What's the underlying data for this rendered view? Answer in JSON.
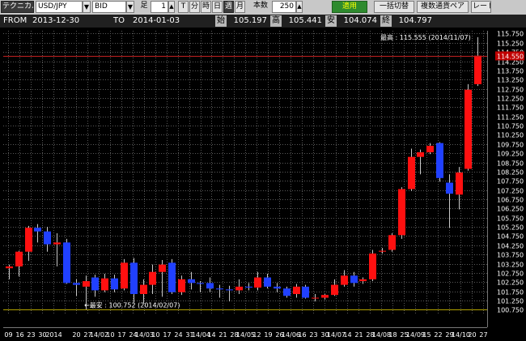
{
  "toolbar": {
    "technical": "テクニカル",
    "pair": "USD/JPY",
    "price_type": "BID",
    "ashi_label": "足",
    "ashi_value": "1",
    "interval_buttons": [
      "T",
      "分",
      "時",
      "日",
      "週",
      "月"
    ],
    "count_label": "本数",
    "count_value": "250",
    "apply": "適用",
    "toggle_all": "一括切替",
    "multi_currency": "複数通貨ペア",
    "rate": "レート"
  },
  "info": {
    "from_label": "FROM",
    "from_value": "2013-12-30",
    "to_label": "TO",
    "to_value": "2014-01-03",
    "open_label": "始",
    "open_value": "105.197",
    "high_label": "高",
    "high_value": "105.441",
    "low_label": "安",
    "low_value": "104.074",
    "close_label": "終",
    "close_value": "104.797"
  },
  "chart_data": {
    "type": "candlestick",
    "ylim": [
      100.5,
      115.9
    ],
    "y_ticks": [
      100.75,
      101.25,
      101.75,
      102.25,
      102.75,
      103.25,
      103.75,
      104.25,
      104.75,
      105.25,
      105.75,
      106.25,
      106.75,
      107.25,
      107.75,
      108.25,
      108.75,
      109.25,
      109.75,
      110.25,
      110.75,
      111.25,
      111.75,
      112.25,
      112.75,
      113.25,
      113.75,
      114.25,
      114.75,
      115.25,
      115.75
    ],
    "y_tick_labels": [
      "100.750",
      "101.250",
      "101.750",
      "102.250",
      "102.750",
      "103.250",
      "103.750",
      "104.250",
      "104.750",
      "105.250",
      "105.750",
      "106.250",
      "106.750",
      "107.250",
      "107.750",
      "108.250",
      "108.750",
      "109.250",
      "109.750",
      "110.250",
      "110.750",
      "111.250",
      "111.750",
      "112.250",
      "112.750",
      "113.250",
      "113.750",
      "114.250",
      "114.750",
      "115.250",
      "115.750"
    ],
    "x_labels": [
      "09",
      "16",
      "23",
      "30",
      "2014",
      "",
      "20",
      "27",
      "14/02",
      "10",
      "17",
      "24",
      "14/03",
      "10",
      "17",
      "24",
      "31",
      "14/04",
      "14",
      "21",
      "28",
      "14/05",
      "12",
      "19",
      "26",
      "14/06",
      "16",
      "23",
      "30",
      "14/07",
      "14",
      "21",
      "28",
      "14/08",
      "18",
      "25",
      "14/09",
      "15",
      "22",
      "29",
      "14/10",
      "20",
      "27"
    ],
    "current_price": 114.55,
    "current_price_label": "114.550",
    "high_annotation": "最高 : 115.555 (2014/11/07)",
    "high_price": 115.555,
    "low_annotation": "←最安 : 100.752 (2014/02/07)",
    "low_price": 100.752,
    "candles": [
      {
        "o": 103.0,
        "h": 103.2,
        "l": 102.4,
        "c": 103.1
      },
      {
        "o": 103.1,
        "h": 103.95,
        "l": 102.55,
        "c": 103.9
      },
      {
        "o": 103.9,
        "h": 105.3,
        "l": 103.4,
        "c": 105.2
      },
      {
        "o": 105.2,
        "h": 105.4,
        "l": 104.4,
        "c": 105.0
      },
      {
        "o": 105.0,
        "h": 105.25,
        "l": 103.9,
        "c": 104.3
      },
      {
        "o": 104.3,
        "h": 104.9,
        "l": 103.1,
        "c": 104.4
      },
      {
        "o": 104.4,
        "h": 104.6,
        "l": 102.15,
        "c": 102.2
      },
      {
        "o": 102.2,
        "h": 102.4,
        "l": 101.5,
        "c": 102.1
      },
      {
        "o": 102.0,
        "h": 102.6,
        "l": 100.752,
        "c": 102.3
      },
      {
        "o": 102.5,
        "h": 102.65,
        "l": 101.45,
        "c": 101.8
      },
      {
        "o": 101.8,
        "h": 102.7,
        "l": 101.7,
        "c": 102.45
      },
      {
        "o": 102.45,
        "h": 102.65,
        "l": 101.7,
        "c": 101.85
      },
      {
        "o": 101.9,
        "h": 103.5,
        "l": 101.8,
        "c": 103.3
      },
      {
        "o": 103.3,
        "h": 103.55,
        "l": 101.15,
        "c": 101.6
      },
      {
        "o": 101.6,
        "h": 102.4,
        "l": 101.1,
        "c": 102.1
      },
      {
        "o": 102.1,
        "h": 103.2,
        "l": 101.6,
        "c": 102.8
      },
      {
        "o": 102.8,
        "h": 103.45,
        "l": 101.45,
        "c": 103.2
      },
      {
        "o": 103.3,
        "h": 103.5,
        "l": 101.6,
        "c": 101.7
      },
      {
        "o": 101.7,
        "h": 102.6,
        "l": 101.55,
        "c": 102.4
      },
      {
        "o": 102.4,
        "h": 102.8,
        "l": 101.85,
        "c": 102.2
      },
      {
        "o": 102.2,
        "h": 102.3,
        "l": 101.7,
        "c": 102.15
      },
      {
        "o": 102.2,
        "h": 102.5,
        "l": 101.7,
        "c": 101.9
      },
      {
        "o": 101.9,
        "h": 102.1,
        "l": 101.4,
        "c": 101.85
      },
      {
        "o": 101.85,
        "h": 102.05,
        "l": 101.2,
        "c": 101.8
      },
      {
        "o": 101.8,
        "h": 102.4,
        "l": 101.6,
        "c": 102.0
      },
      {
        "o": 102.0,
        "h": 102.2,
        "l": 101.8,
        "c": 101.95
      },
      {
        "o": 101.95,
        "h": 102.8,
        "l": 101.8,
        "c": 102.5
      },
      {
        "o": 102.5,
        "h": 102.7,
        "l": 101.9,
        "c": 102.0
      },
      {
        "o": 102.0,
        "h": 102.2,
        "l": 101.7,
        "c": 101.9
      },
      {
        "o": 101.9,
        "h": 102.0,
        "l": 101.4,
        "c": 101.5
      },
      {
        "o": 101.6,
        "h": 102.15,
        "l": 101.4,
        "c": 102.0
      },
      {
        "o": 102.0,
        "h": 102.1,
        "l": 101.35,
        "c": 101.4
      },
      {
        "o": 101.4,
        "h": 101.6,
        "l": 101.2,
        "c": 101.4
      },
      {
        "o": 101.4,
        "h": 101.6,
        "l": 101.3,
        "c": 101.55
      },
      {
        "o": 101.55,
        "h": 102.4,
        "l": 101.5,
        "c": 102.1
      },
      {
        "o": 102.1,
        "h": 102.9,
        "l": 102.0,
        "c": 102.6
      },
      {
        "o": 102.6,
        "h": 102.8,
        "l": 102.0,
        "c": 102.2
      },
      {
        "o": 102.3,
        "h": 102.5,
        "l": 102.15,
        "c": 102.4
      },
      {
        "o": 102.4,
        "h": 104.0,
        "l": 102.3,
        "c": 103.8
      },
      {
        "o": 103.9,
        "h": 104.1,
        "l": 103.8,
        "c": 103.95
      },
      {
        "o": 104.0,
        "h": 104.9,
        "l": 103.9,
        "c": 104.8
      },
      {
        "o": 104.8,
        "h": 107.4,
        "l": 104.6,
        "c": 107.3
      },
      {
        "o": 107.3,
        "h": 109.5,
        "l": 107.2,
        "c": 109.05
      },
      {
        "o": 109.05,
        "h": 109.45,
        "l": 108.1,
        "c": 109.3
      },
      {
        "o": 109.3,
        "h": 109.8,
        "l": 109.2,
        "c": 109.65
      },
      {
        "o": 109.8,
        "h": 109.85,
        "l": 107.7,
        "c": 107.9
      },
      {
        "o": 107.65,
        "h": 108.1,
        "l": 105.2,
        "c": 107.05
      },
      {
        "o": 107.0,
        "h": 108.5,
        "l": 106.2,
        "c": 108.2
      },
      {
        "o": 108.4,
        "h": 113.0,
        "l": 108.3,
        "c": 112.7
      },
      {
        "o": 113.0,
        "h": 115.555,
        "l": 112.9,
        "c": 114.55
      }
    ]
  }
}
